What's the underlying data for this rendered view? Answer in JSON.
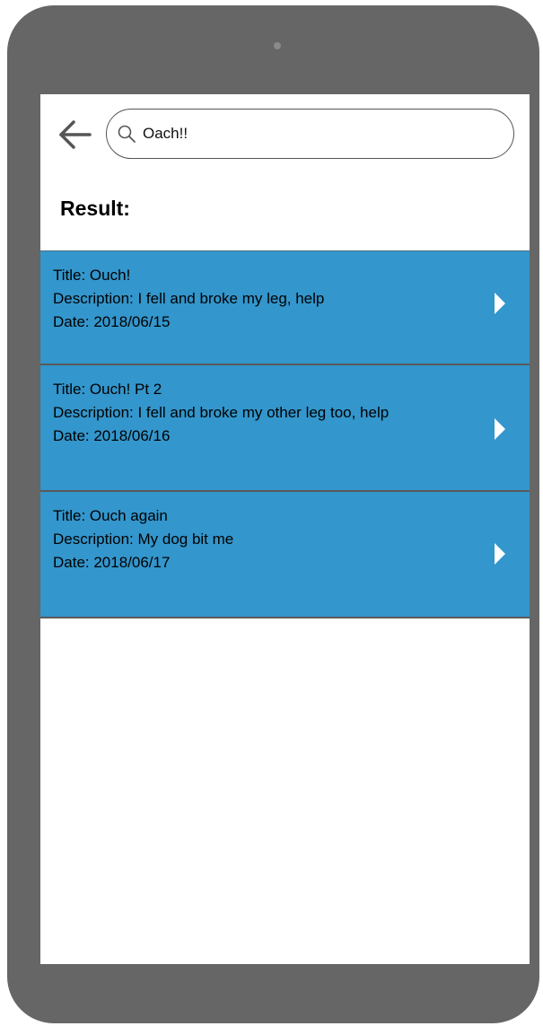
{
  "search": {
    "value": "Oach!!",
    "placeholder": ""
  },
  "result_heading": "Result:",
  "results": [
    {
      "title": "Title: Ouch!",
      "description": "Description: I fell and broke my leg, help",
      "date": "Date: 2018/06/15"
    },
    {
      "title": "Title: Ouch! Pt 2",
      "description": "Description: I fell and broke my other leg too, help",
      "date": "Date: 2018/06/16"
    },
    {
      "title": "Title: Ouch again",
      "description": "Description: My dog bit me",
      "date": "Date: 2018/06/17"
    }
  ],
  "colors": {
    "device_frame": "#666666",
    "result_background": "#3396cc",
    "screen_background": "#ffffff"
  },
  "icons": {
    "back": "arrow-left-icon",
    "search": "search-icon",
    "open_item": "chevron-right-icon"
  }
}
